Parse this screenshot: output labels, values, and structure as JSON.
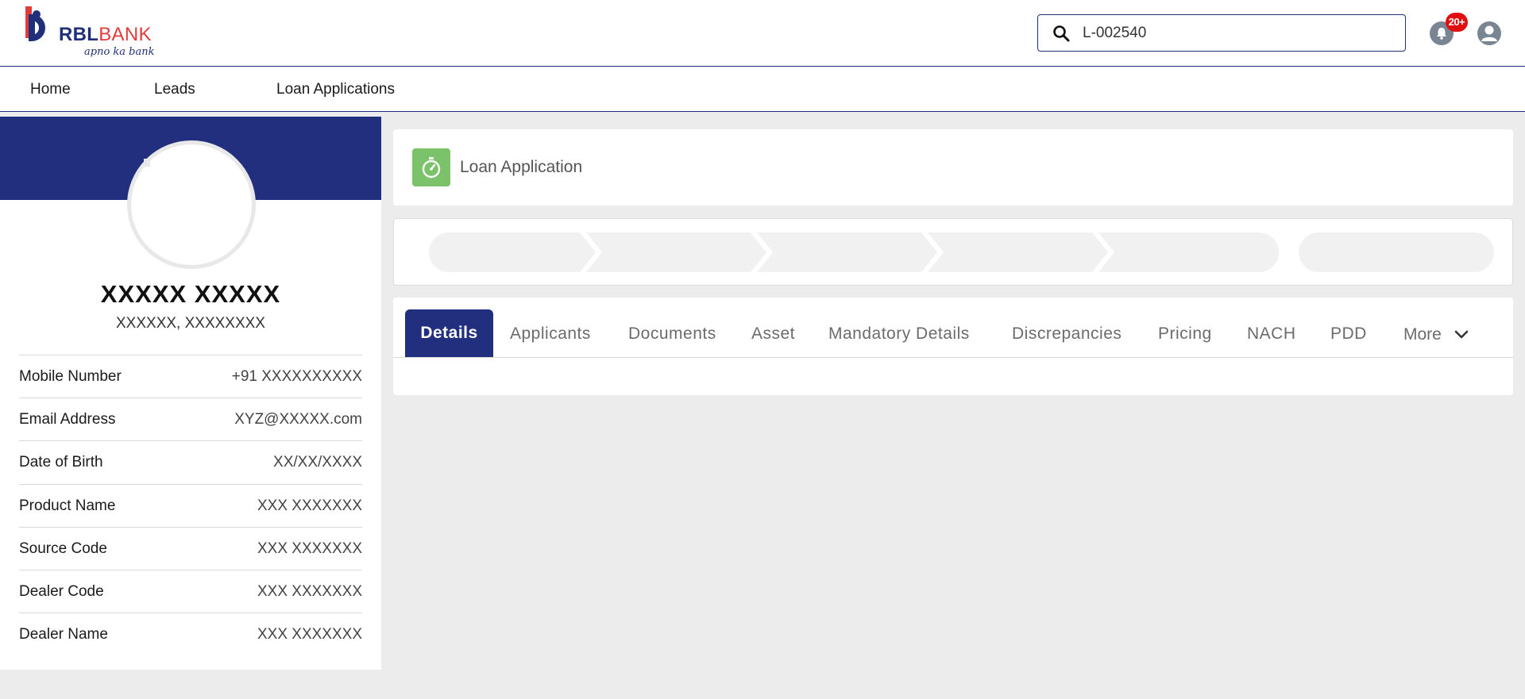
{
  "brand": {
    "name_primary": "RBL",
    "name_secondary": "BANK",
    "tagline": "apno ka bank",
    "colors": {
      "navy": "#222f7e",
      "red": "#e23b3b",
      "green": "#7cc26a",
      "badge": "#e01010"
    }
  },
  "search": {
    "value": "L-002540",
    "icon": "search-icon"
  },
  "notifications": {
    "badge": "20+",
    "icon": "bell-icon"
  },
  "user": {
    "icon": "user-avatar-icon"
  },
  "nav": {
    "items": [
      {
        "label": "Home"
      },
      {
        "label": "Leads"
      },
      {
        "label": "Loan Applications"
      }
    ]
  },
  "profile": {
    "name": "XXXXX XXXXX",
    "subtitle": "XXXXXX, XXXXXXXX",
    "fields": [
      {
        "label": "Mobile Number",
        "value": "+91 XXXXXXXXXX"
      },
      {
        "label": "Email Address",
        "value": "XYZ@XXXXX.com"
      },
      {
        "label": "Date of Birth",
        "value": "XX/XX/XXXX"
      },
      {
        "label": "Product Name",
        "value": "XXX XXXXXXX"
      },
      {
        "label": "Source Code",
        "value": "XXX XXXXXXX"
      },
      {
        "label": "Dealer Code",
        "value": "XXX XXXXXXX"
      },
      {
        "label": "Dealer Name",
        "value": "XXX XXXXXXX"
      }
    ]
  },
  "record": {
    "title": "Loan Application",
    "icon": "stopwatch-icon"
  },
  "tabs": {
    "items": [
      {
        "label": "Details"
      },
      {
        "label": "Applicants"
      },
      {
        "label": "Documents"
      },
      {
        "label": "Asset"
      },
      {
        "label": "Mandatory Details"
      },
      {
        "label": "Discrepancies"
      },
      {
        "label": "Pricing"
      },
      {
        "label": "NACH"
      },
      {
        "label": "PDD"
      }
    ],
    "more_label": "More",
    "active": "Details"
  }
}
